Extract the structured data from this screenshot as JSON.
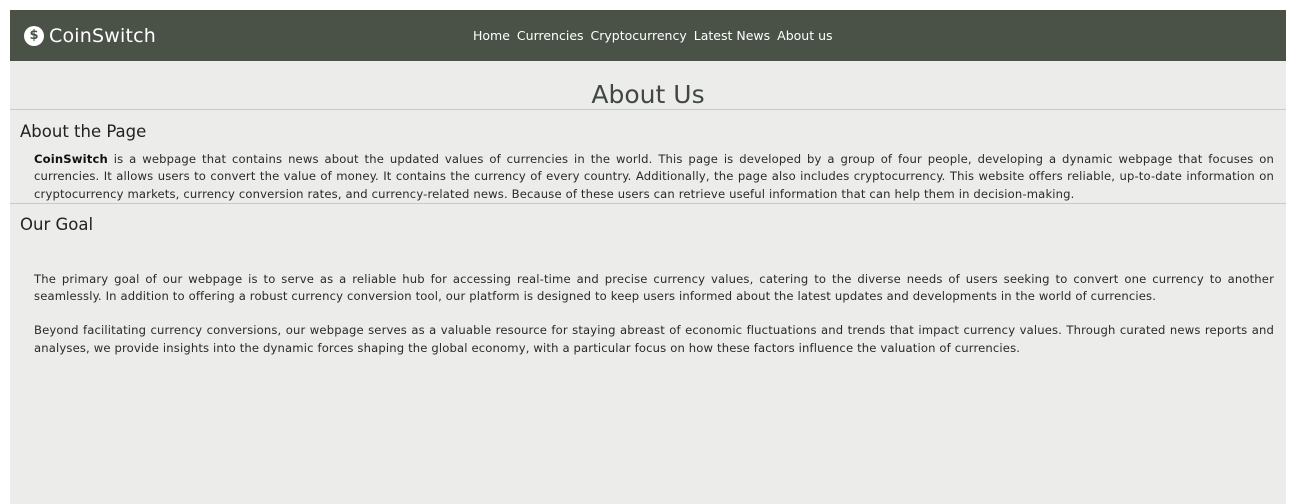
{
  "nav": {
    "brand_icon": "$",
    "brand_name": "CoinSwitch",
    "links": [
      "Home",
      "Currencies",
      "Cryptocurrency",
      "Latest News",
      "About us"
    ]
  },
  "page": {
    "title": "About Us"
  },
  "about_page": {
    "heading": "About the Page",
    "brand_bold": "CoinSwitch",
    "text": " is a webpage that contains news about the updated values of currencies in the world. This page is developed by a group of four people, developing a dynamic webpage that focuses on currencies. It allows users to convert the value of money. It contains the currency of every country. Additionally, the page also includes cryptocurrency. This website offers reliable, up-to-date information on cryptocurrency markets, currency conversion rates, and currency-related news. Because of these users can retrieve useful information that can help them in decision-making."
  },
  "our_goal": {
    "heading": "Our Goal",
    "paragraph_1": "The primary goal of our webpage is to serve as a reliable hub for accessing real-time and precise currency values, catering to the diverse needs of users seeking to convert one currency to another seamlessly. In addition to offering a robust currency conversion tool, our platform is designed to keep users informed about the latest updates and developments in the world of currencies.",
    "paragraph_2": "Beyond facilitating currency conversions, our webpage serves as a valuable resource for staying abreast of economic fluctuations and trends that impact currency values. Through curated news reports and analyses, we provide insights into the dynamic forces shaping the global economy, with a particular focus on how these factors influence the valuation of currencies."
  },
  "colors": {
    "navbar": "#4a5147",
    "background": "#ececeb",
    "title": "#404840"
  },
  "icons": {
    "brand": "dollar-coin-icon"
  }
}
